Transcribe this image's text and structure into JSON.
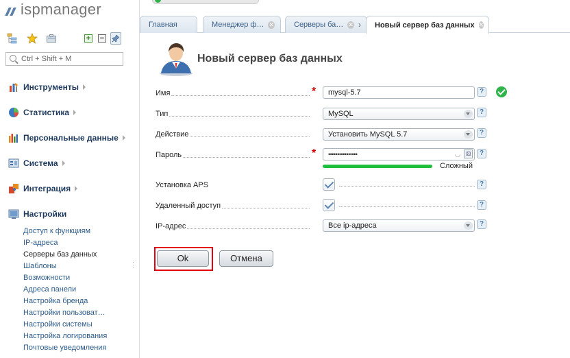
{
  "app": {
    "logo_text": "ispmanager"
  },
  "sidebar": {
    "search_placeholder": "Ctrl + Shift + M",
    "toolbar_icons": [
      "tree-icon",
      "star-icon",
      "briefcase-icon",
      "expand-icon",
      "collapse-icon",
      "pin-icon"
    ],
    "groups": [
      {
        "label": "Инструменты",
        "icon": "tools-icon"
      },
      {
        "label": "Статистика",
        "icon": "chart-pie-icon"
      },
      {
        "label": "Персональные данные",
        "icon": "bar-chart-icon"
      },
      {
        "label": "Система",
        "icon": "system-icon"
      },
      {
        "label": "Интеграция",
        "icon": "puzzle-icon"
      },
      {
        "label": "Настройки",
        "icon": "settings-icon"
      }
    ],
    "settings_items": [
      "Доступ к функциям",
      "IP-адреса",
      "Серверы баз данных",
      "Шаблоны",
      "Возможности",
      "Адреса панели",
      "Настройка бренда",
      "Настройки пользоват…",
      "Настройки системы",
      "Настройка логирования",
      "Почтовые уведомления"
    ],
    "active_item": "Серверы баз данных"
  },
  "tabs": [
    {
      "label": "Главная",
      "closable": false
    },
    {
      "label": "Менеджер ф…",
      "closable": true
    },
    {
      "label": "Серверы ба…",
      "closable": true
    },
    {
      "label": "Новый сервер баз данных",
      "closable": true,
      "active": true
    }
  ],
  "form": {
    "title": "Новый сервер баз данных",
    "fields": {
      "name": {
        "label": "Имя",
        "value": "mysql-5.7",
        "required": true
      },
      "type": {
        "label": "Тип",
        "value": "MySQL"
      },
      "action": {
        "label": "Действие",
        "value": "Установить MySQL 5.7"
      },
      "password": {
        "label": "Пароль",
        "value": "••••••••••••••••",
        "required": true
      },
      "strength": {
        "label": "Сложный",
        "level": 1.0
      },
      "aps": {
        "label": "Установка APS",
        "checked": true
      },
      "remote": {
        "label": "Удаленный доступ",
        "checked": true
      },
      "ip": {
        "label": "IP-адрес",
        "value": "Все ip-адреса"
      }
    },
    "help_glyph": "?",
    "buttons": {
      "ok": "Ok",
      "cancel": "Отмена"
    }
  },
  "colors": {
    "accent": "#2d5c8a",
    "success": "#2fb34a",
    "strength": "#1ebf3b",
    "highlight": "#e30010",
    "required": "#d40000"
  }
}
